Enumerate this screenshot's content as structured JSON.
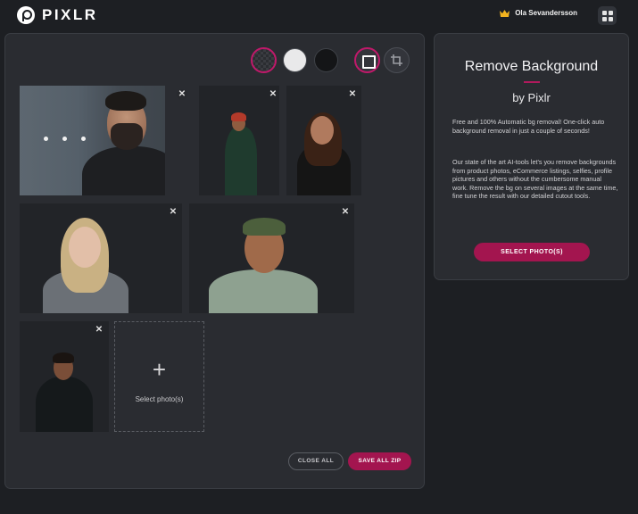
{
  "app": {
    "name": "PIXLR",
    "logo_icon": "pixlr-logo-icon"
  },
  "header": {
    "user_name": "Ola Sevandersson",
    "crown_icon": "crown-icon",
    "apps_icon": "apps-grid-icon"
  },
  "toolbar": {
    "background_options": [
      "transparent",
      "white",
      "black"
    ],
    "tools": [
      "frame-icon",
      "crop-icon"
    ],
    "accent_color": "#c0196a"
  },
  "photos": [
    {
      "id": "photo-1",
      "state": "processing",
      "close": "✕"
    },
    {
      "id": "photo-2",
      "state": "done",
      "close": "✕"
    },
    {
      "id": "photo-3",
      "state": "done",
      "close": "✕"
    },
    {
      "id": "photo-4",
      "state": "done",
      "close": "✕"
    },
    {
      "id": "photo-5",
      "state": "done",
      "close": "✕"
    },
    {
      "id": "photo-6",
      "state": "done",
      "close": "✕"
    }
  ],
  "add_tile": {
    "plus": "+",
    "label": "Select photo(s)"
  },
  "actions": {
    "close_all": "CLOSE ALL",
    "save_all": "SAVE ALL ZIP"
  },
  "info": {
    "title": "Remove Background",
    "subtitle": "by Pixlr",
    "paragraph1": "Free and 100% Automatic bg removal! One-click auto background removal in just a couple of seconds!",
    "paragraph2": "Our state of the art AI-tools let's you remove backgrounds from product photos, eCommerce listings, selfies, profile pictures and others without the cumbersome manual work. Remove the bg on several images at the same time, fine tune the result with our detailed cutout tools.",
    "select_button": "SELECT PHOTO(S)",
    "accent_color": "#a3154f"
  }
}
